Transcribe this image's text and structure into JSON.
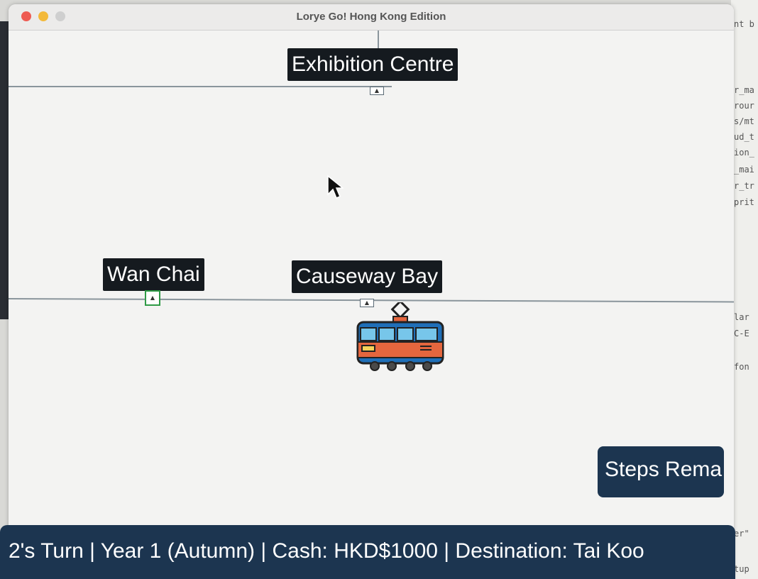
{
  "window": {
    "title": "Lorye Go! Hong Kong Edition"
  },
  "stations": {
    "exhibition": "Exhibition Centre",
    "wanchai": "Wan Chai",
    "causeway": "Causeway Bay"
  },
  "steps_panel": {
    "label": "Steps Rema"
  },
  "status_bar": {
    "text": "2's Turn | Year 1 (Autumn) | Cash: HKD$1000 | Destination: Tai Koo"
  },
  "background_editor": {
    "lines": [
      "nt b",
      "r_ma",
      "rour",
      "s/mt",
      "ud_t",
      "ion_",
      "_mai",
      "r_tr",
      "prit",
      "lar",
      "C-E",
      "fon",
      "er\"",
      "tup"
    ]
  },
  "colors": {
    "station_label_bg": "#151a1f",
    "panel_bg": "#1c3550",
    "track": "#8a959c",
    "tram_body": "#e4663e",
    "tram_windows": "#77c6ea",
    "tram_trim": "#1f6fb8"
  }
}
